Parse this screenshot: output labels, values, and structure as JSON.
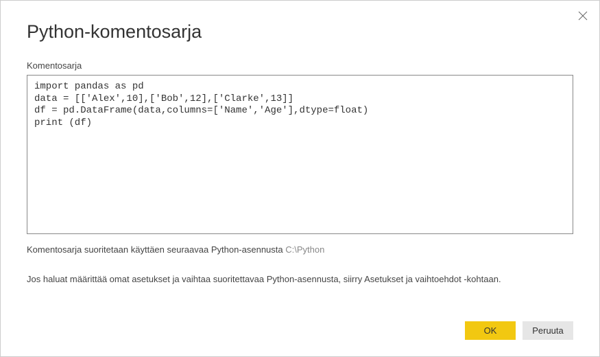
{
  "dialog": {
    "title": "Python-komentosarja",
    "script_label": "Komentosarja",
    "script_content": "import pandas as pd\ndata = [['Alex',10],['Bob',12],['Clarke',13]]\ndf = pd.DataFrame(data,columns=['Name','Age'],dtype=float)\nprint (df)",
    "install_info_prefix": "Komentosarja suoritetaan käyttäen seuraavaa Python-asennusta ",
    "install_path": "C:\\Python",
    "settings_info": "Jos haluat määrittää omat asetukset ja vaihtaa suoritettavaa Python-asennusta, siirry Asetukset ja vaihtoehdot -kohtaan.",
    "ok_label": "OK",
    "cancel_label": "Peruuta"
  }
}
